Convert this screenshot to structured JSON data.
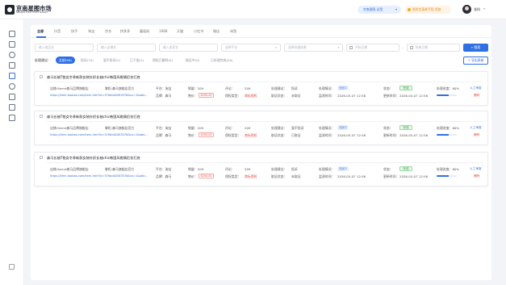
{
  "brand": {
    "name": "京南星图市场",
    "subtitle": "JINGNAN STAR CHART MARKET"
  },
  "header": {
    "plan_label": "京南星图-试用",
    "plan_caret": "▾",
    "promo_label": "限时优惠券手段 领取",
    "user_name": "张科",
    "user_caret": "▾"
  },
  "sidebar": {
    "icons": [
      "home-icon",
      "message-icon",
      "target-icon",
      "shield-icon",
      "document-icon",
      "chart-icon",
      "data-icon",
      "folder-icon",
      "list-icon"
    ],
    "footer_icon": "settings-icon"
  },
  "tabs": [
    "全部",
    "抖音",
    "快手",
    "淘宝",
    "京东",
    "拼多多",
    "蘑菇街",
    "1688",
    "天猫",
    "小红书",
    "微店",
    "闲鱼"
  ],
  "filters": {
    "product_name_placeholder": "输入商品名",
    "shop_name_placeholder": "输入店铺名",
    "seller_name_placeholder": "输入卖家名",
    "platform_placeholder": "选择平台",
    "status_placeholder": "选择处理结果",
    "start_date_placeholder": "开始日期",
    "date_separator": "-",
    "end_date_placeholder": "结束日期",
    "search_label": "搜索",
    "caret": "▾"
  },
  "status_filter": {
    "label": "处理建议：",
    "chips": [
      "全部(90)",
      "投诉(70)",
      "暂不投诉(2)",
      "已下架(1)",
      "侵权已删除(0)",
      "取证中(0)",
      "已处理完成(20)"
    ],
    "export_label": "导出表格"
  },
  "listing_labels": {
    "platform": "平台：",
    "sales": "销量：",
    "reviews": "评论：",
    "advice": "处理建议：",
    "handle_status": "处理情况：",
    "status": "状态：",
    "progress": "处理进度：",
    "brand": "品牌：",
    "price": "售价：",
    "infringe_type": "侵权类型：",
    "evidence": "取证状态：",
    "monitor_time": "监测时间：",
    "update_time": "更新时间：",
    "manual_review": "人工审查",
    "delete": "删除"
  },
  "listings": [
    {
      "title": "森马长袖T恤女冬季新款女装针织长袖chic韩国风格情侣衣打底",
      "shop": "店铺:Semir森马品牌旗舰店",
      "seller": "掌柜:森马旗舰店官方",
      "link": "https://item.taobao.com/item.htm?id=576ddd2083578&ns=1&abb...",
      "platform": "淘宝",
      "brand": "森马",
      "sales": "209",
      "price": "¥200.00",
      "reviews": "209",
      "infringe_type": "商标侵权",
      "advice": "投诉",
      "evidence": "未取证",
      "handle_status": "去处中",
      "monitor_time": "2026-05-07 12:56",
      "status": "完成",
      "update_time": "2026-05-07 12:56",
      "progress_label": "60%",
      "progress": 0.6
    },
    {
      "title": "森马长袖T恤女冬季新款女装针织长袖chic韩国风格情侣衣打底",
      "shop": "店铺:Semir森马品牌旗舰店",
      "seller": "掌柜:森马旗舰店官方",
      "link": "https://item.taobao.com/item.htm?id=576ddd2083578&ns=1&abb...",
      "platform": "淘宝",
      "brand": "森马",
      "sales": "209",
      "price": "¥200.00",
      "reviews": "209",
      "infringe_type": "商标侵权",
      "advice": "暂不投诉",
      "evidence": "已取证",
      "handle_status": "去处中",
      "monitor_time": "2026-05-07 12:56",
      "status": "完成",
      "update_time": "2026-05-07 12:56",
      "progress_label": "60%",
      "progress": 0.6
    },
    {
      "title": "森马长袖T恤女冬季新款女装针织长袖chic韩国风格情侣衣打底",
      "shop": "店铺:Semir森马品牌旗舰店",
      "seller": "掌柜:森马旗舰店官方",
      "link": "https://item.taobao.com/item.htm?id=576ddd2083578&ns=1&abb...",
      "platform": "淘宝",
      "brand": "森马",
      "sales": "209",
      "price": "¥200.00",
      "reviews": "209",
      "infringe_type": "商标侵权",
      "advice": "投诉",
      "evidence": "未取证",
      "handle_status": "去处中",
      "monitor_time": "2026-05-07 12:56",
      "status": "完成",
      "update_time": "2026-05-07 12:56",
      "progress_label": "60%",
      "progress": 0.6
    }
  ],
  "colors": {
    "accent": "#2f6fe4",
    "danger": "#e2463e",
    "success": "#2f9e44",
    "promo": "#e88a1a"
  }
}
